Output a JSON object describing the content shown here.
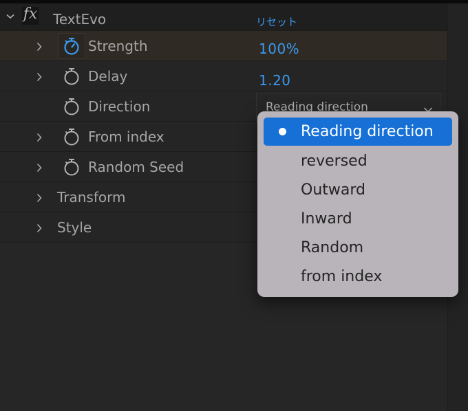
{
  "effect": {
    "name": "TextEvo",
    "fx_label": "fx",
    "reset_label": "リセット",
    "expanded": true
  },
  "properties": [
    {
      "label": "Strength",
      "value": "100%",
      "has_twirl": true,
      "stopwatch_active": true,
      "highlighted": true
    },
    {
      "label": "Delay",
      "value": "1.20",
      "has_twirl": true,
      "stopwatch_active": false
    },
    {
      "label": "Direction",
      "value": "Reading direction",
      "has_twirl": false,
      "stopwatch_active": false,
      "control": "dropdown"
    },
    {
      "label": "From index",
      "has_twirl": true,
      "stopwatch_active": false
    },
    {
      "label": "Random Seed",
      "has_twirl": true,
      "stopwatch_active": false
    }
  ],
  "groups": [
    {
      "label": "Transform"
    },
    {
      "label": "Style"
    }
  ],
  "dropdown_menu": {
    "selected_index": 0,
    "options": [
      "Reading direction",
      "reversed",
      "Outward",
      "Inward",
      "Random",
      "from index"
    ]
  },
  "colors": {
    "accent": "#3b9af0",
    "menu_selection": "#1670d6",
    "menu_background": "#b9b4b9",
    "row_highlight": "#302a24"
  }
}
